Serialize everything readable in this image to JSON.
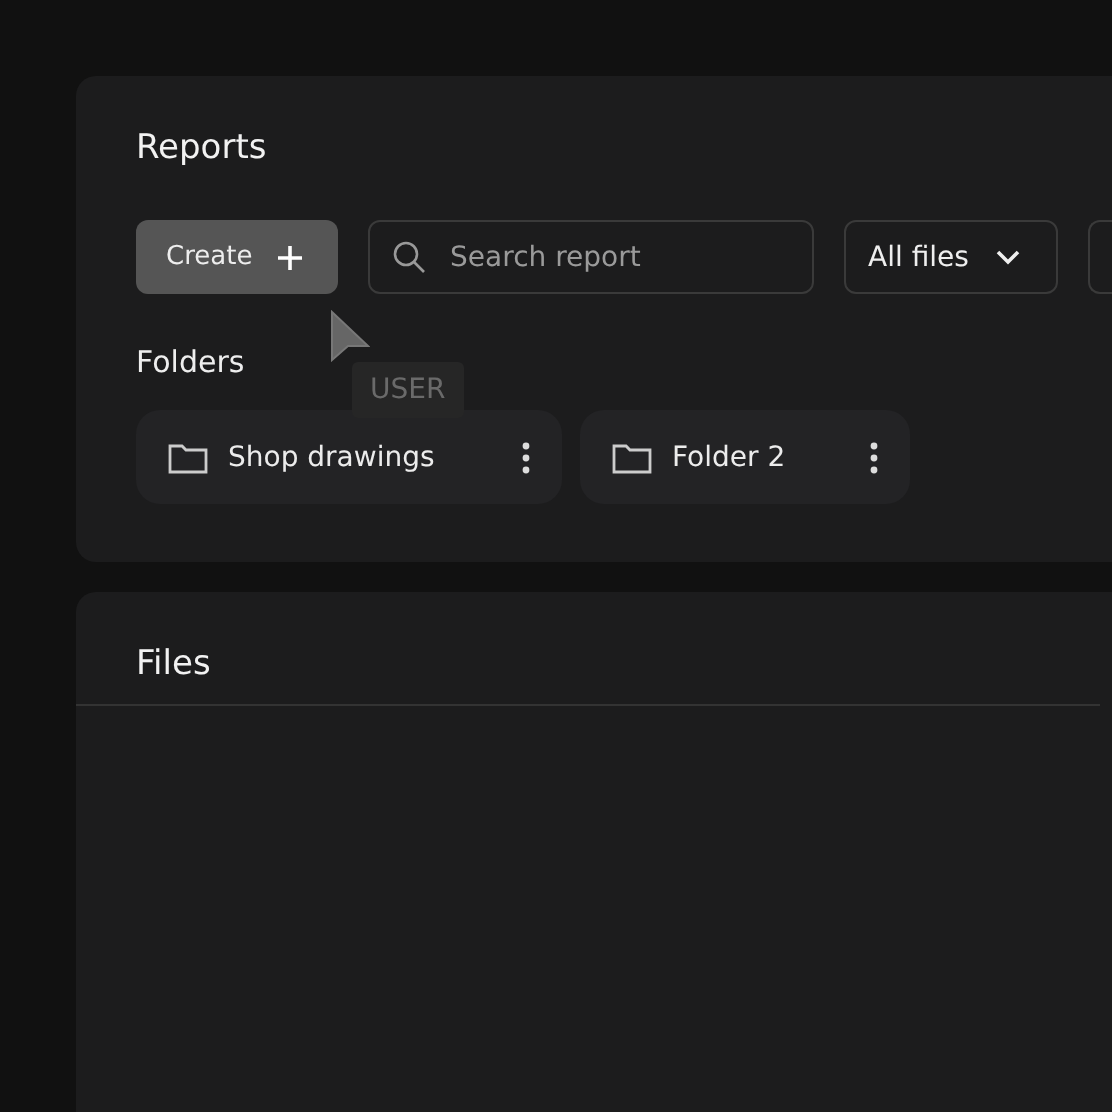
{
  "reports": {
    "title": "Reports",
    "create_button": "Create",
    "search": {
      "placeholder": "Search report"
    },
    "filter": {
      "value": "All files"
    },
    "folders_heading": "Folders",
    "folders": [
      {
        "name": "Shop drawings"
      },
      {
        "name": "Folder 2"
      }
    ]
  },
  "cursor_tooltip": "USER",
  "files": {
    "title": "Files"
  }
}
